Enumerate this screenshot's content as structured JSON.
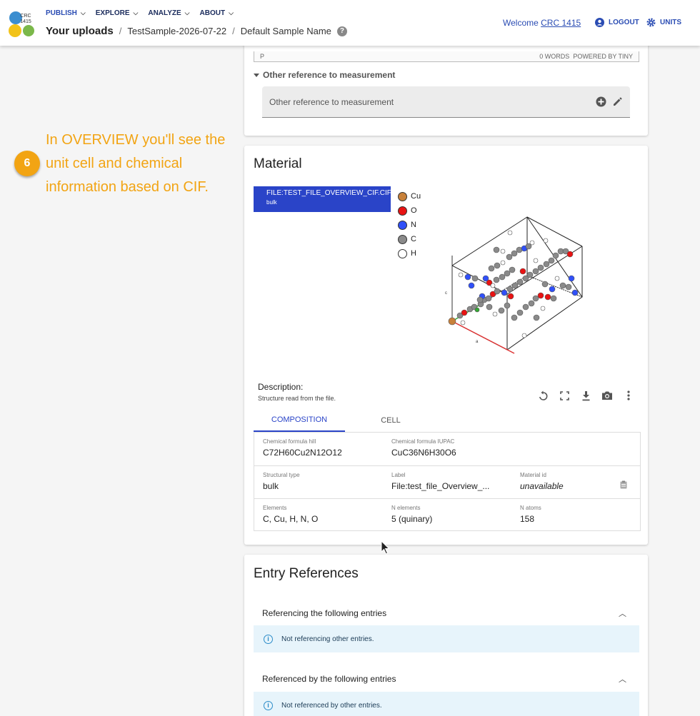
{
  "header": {
    "logo_text": "CRC 1415",
    "nav": [
      {
        "label": "PUBLISH",
        "active": true
      },
      {
        "label": "EXPLORE",
        "active": false
      },
      {
        "label": "ANALYZE",
        "active": false
      },
      {
        "label": "ABOUT",
        "active": false
      }
    ],
    "breadcrumb": [
      "Your uploads",
      "TestSample-2026-07-22",
      "Default Sample Name"
    ],
    "welcome_prefix": "Welcome",
    "user": "CRC 1415",
    "logout": "LOGOUT",
    "units": "UNITS"
  },
  "editor": {
    "path": "P",
    "words": "0 WORDS",
    "powered": "POWERED BY TINY"
  },
  "other_reference": {
    "section_label": "Other reference to measurement",
    "placeholder": "Other reference to measurement"
  },
  "annotation": {
    "number": "6",
    "text": "In OVERVIEW you'll see the unit cell and chemical information based on CIF."
  },
  "material": {
    "title": "Material",
    "selected_entry": {
      "title": "FILE:TEST_FILE_OVERVIEW_CIF.CIF",
      "subtitle": "bulk"
    },
    "legend": [
      {
        "element": "Cu",
        "color": "#c8813a"
      },
      {
        "element": "O",
        "color": "#e81313"
      },
      {
        "element": "N",
        "color": "#3050f8"
      },
      {
        "element": "C",
        "color": "#8a8a8a"
      },
      {
        "element": "H",
        "color": "#ffffff"
      }
    ],
    "description_label": "Description:",
    "description": "Structure read from the file.",
    "tabs": [
      {
        "label": "COMPOSITION",
        "active": true
      },
      {
        "label": "CELL",
        "active": false
      }
    ],
    "properties": {
      "formula_hill_label": "Chemical formula hill",
      "formula_hill": "C72H60Cu2N12O12",
      "formula_iupac_label": "Chemical formula IUPAC",
      "formula_iupac": "CuC36N6H30O6",
      "structural_type_label": "Structural type",
      "structural_type": "bulk",
      "label_label": "Label",
      "label": "File:test_file_Overview_...",
      "material_id_label": "Material id",
      "material_id": "unavailable",
      "elements_label": "Elements",
      "elements": "C, Cu, H, N, O",
      "n_elements_label": "N elements",
      "n_elements": "5 (quinary)",
      "n_atoms_label": "N atoms",
      "n_atoms": "158"
    }
  },
  "entry_references": {
    "title": "Entry References",
    "referencing_label": "Referencing the following entries",
    "referencing_info": "Not referencing other entries.",
    "referenced_label": "Referenced by the following entries",
    "referenced_info": "Not referenced by other entries."
  }
}
